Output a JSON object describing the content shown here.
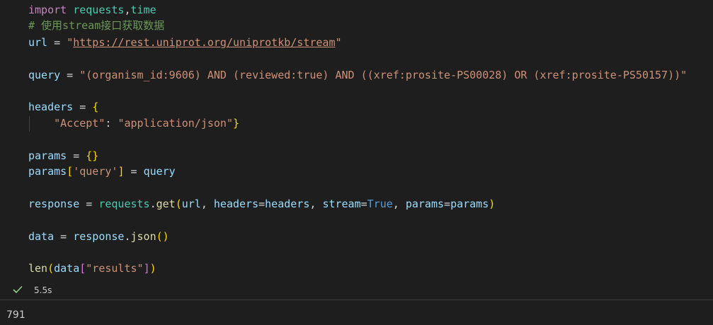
{
  "cell": {
    "code": {
      "line_import": {
        "kw": "import",
        "mod1": "requests",
        "comma": ",",
        "mod2": "time"
      },
      "comment": "# 使用stream接口获取数据",
      "line_url": {
        "var": "url",
        "op": " = ",
        "str_q1": "\"",
        "str_link": "https://rest.uniprot.org/uniprotkb/stream",
        "str_q2": "\""
      },
      "line_query": {
        "var": "query",
        "op": " = ",
        "str": "\"(organism_id:9606) AND (reviewed:true) AND ((xref:prosite-PS00028) OR (xref:prosite-PS50157))\""
      },
      "line_headers": {
        "var": "headers",
        "op": " = ",
        "brace": "{"
      },
      "line_accept": {
        "key": "\"Accept\"",
        "colon": ": ",
        "val": "\"application/json\"",
        "brace": "}"
      },
      "line_params_init": {
        "var": "params",
        "op": " = ",
        "braces": "{}"
      },
      "line_params_set": {
        "var": "params",
        "br_open": "[",
        "key": "'query'",
        "br_close": "]",
        "op": " = ",
        "val": "query"
      },
      "line_response": {
        "var": "response",
        "op": " = ",
        "mod": "requests",
        "dot": ".",
        "fn": "get",
        "po": "(",
        "a1": "url",
        "c1": ", ",
        "k2": "headers",
        "e2": "=",
        "v2": "headers",
        "c2": ", ",
        "k3": "stream",
        "e3": "=",
        "v3": "True",
        "c3": ", ",
        "k4": "params",
        "e4": "=",
        "v4": "params",
        "pc": ")"
      },
      "line_data": {
        "var": "data",
        "op": " = ",
        "obj": "response",
        "dot": ".",
        "fn": "json",
        "parens": "()"
      },
      "line_len": {
        "fn": "len",
        "po": "(",
        "var": "data",
        "bo": "[",
        "key": "\"results\"",
        "bc": "]",
        "pc": ")"
      }
    },
    "status": {
      "icon": "checkmark-icon",
      "exec_time": "5.5s",
      "success_color": "#89d185"
    },
    "output": {
      "text": "791"
    }
  }
}
